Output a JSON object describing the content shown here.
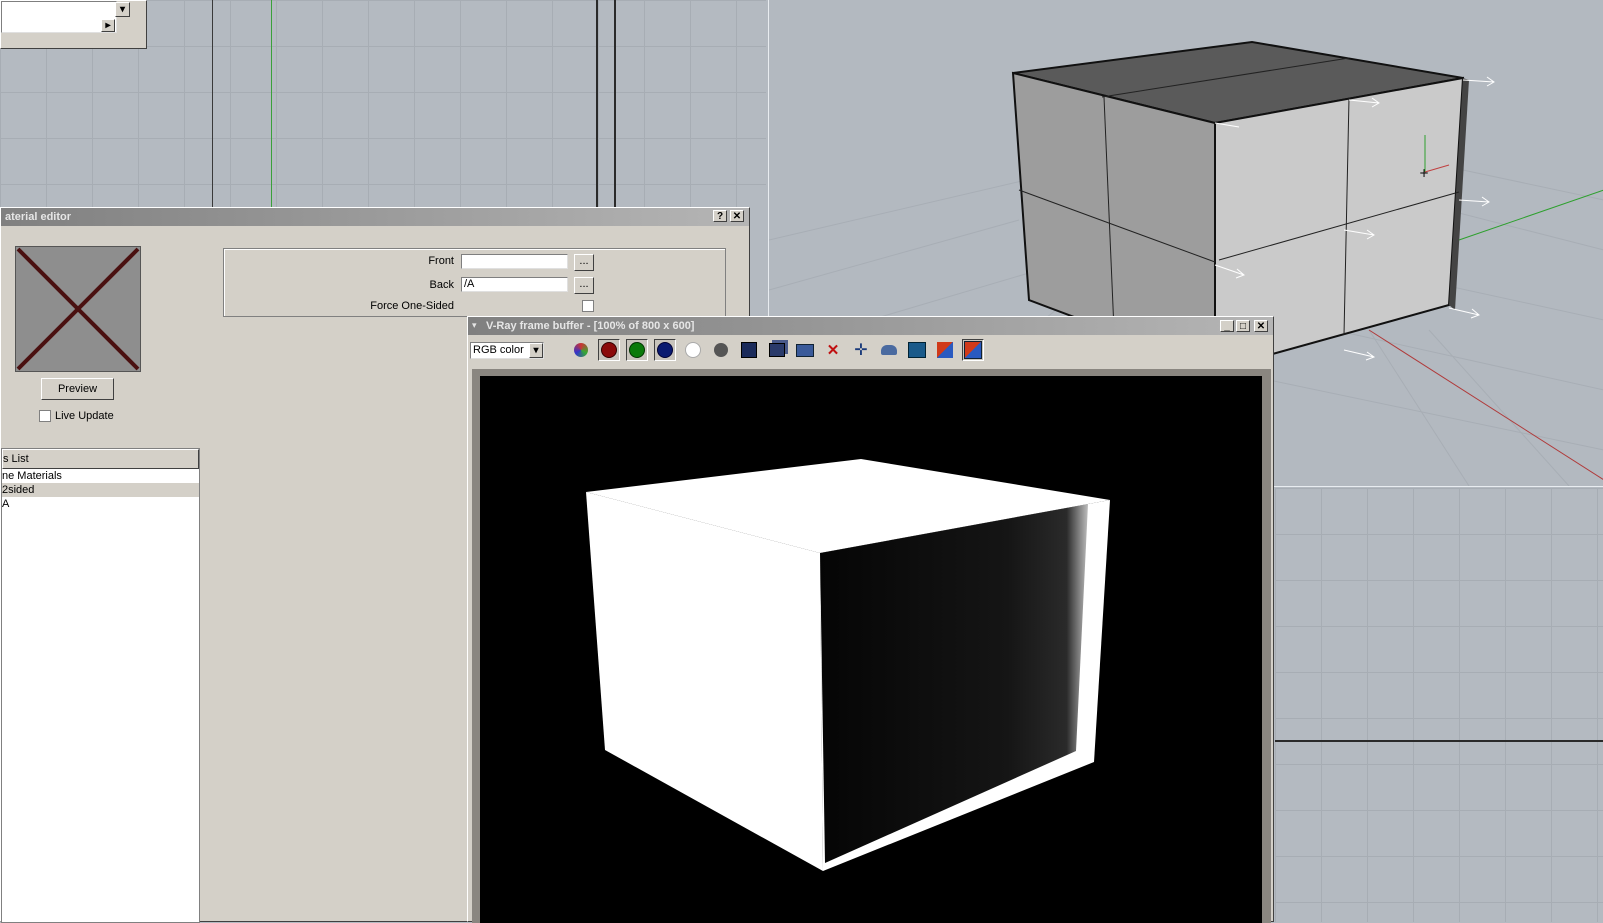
{
  "top_combo": {
    "value": ""
  },
  "material_editor": {
    "title": "aterial editor",
    "help_btn": "?",
    "close_btn": "✕",
    "front_label": "Front",
    "front_value": "",
    "back_label": "Back",
    "back_value": "/A",
    "browse_label": "...",
    "force_label": "Force One-Sided",
    "preview_label": "Preview",
    "live_update_label": "Live Update",
    "list_header": "s List",
    "list_items": [
      "ne Materials",
      "2sided",
      "A"
    ]
  },
  "vfb": {
    "title": "V-Ray frame buffer - [100% of 800 x 600]",
    "channel_value": "RGB color",
    "icons": [
      "rgb-channels-icon",
      "red-channel-icon",
      "green-channel-icon",
      "blue-channel-icon",
      "alpha-channel-icon",
      "monochrome-icon",
      "save-image-icon",
      "save-all-icon",
      "load-image-icon",
      "clear-image-icon",
      "track-mouse-icon",
      "render-last-icon",
      "region-render-icon",
      "compare-a-icon",
      "compare-b-icon"
    ]
  },
  "colors": {
    "win_bg": "#d4d0c8",
    "title_inactive": "#808080",
    "render_bg": "#000000"
  }
}
